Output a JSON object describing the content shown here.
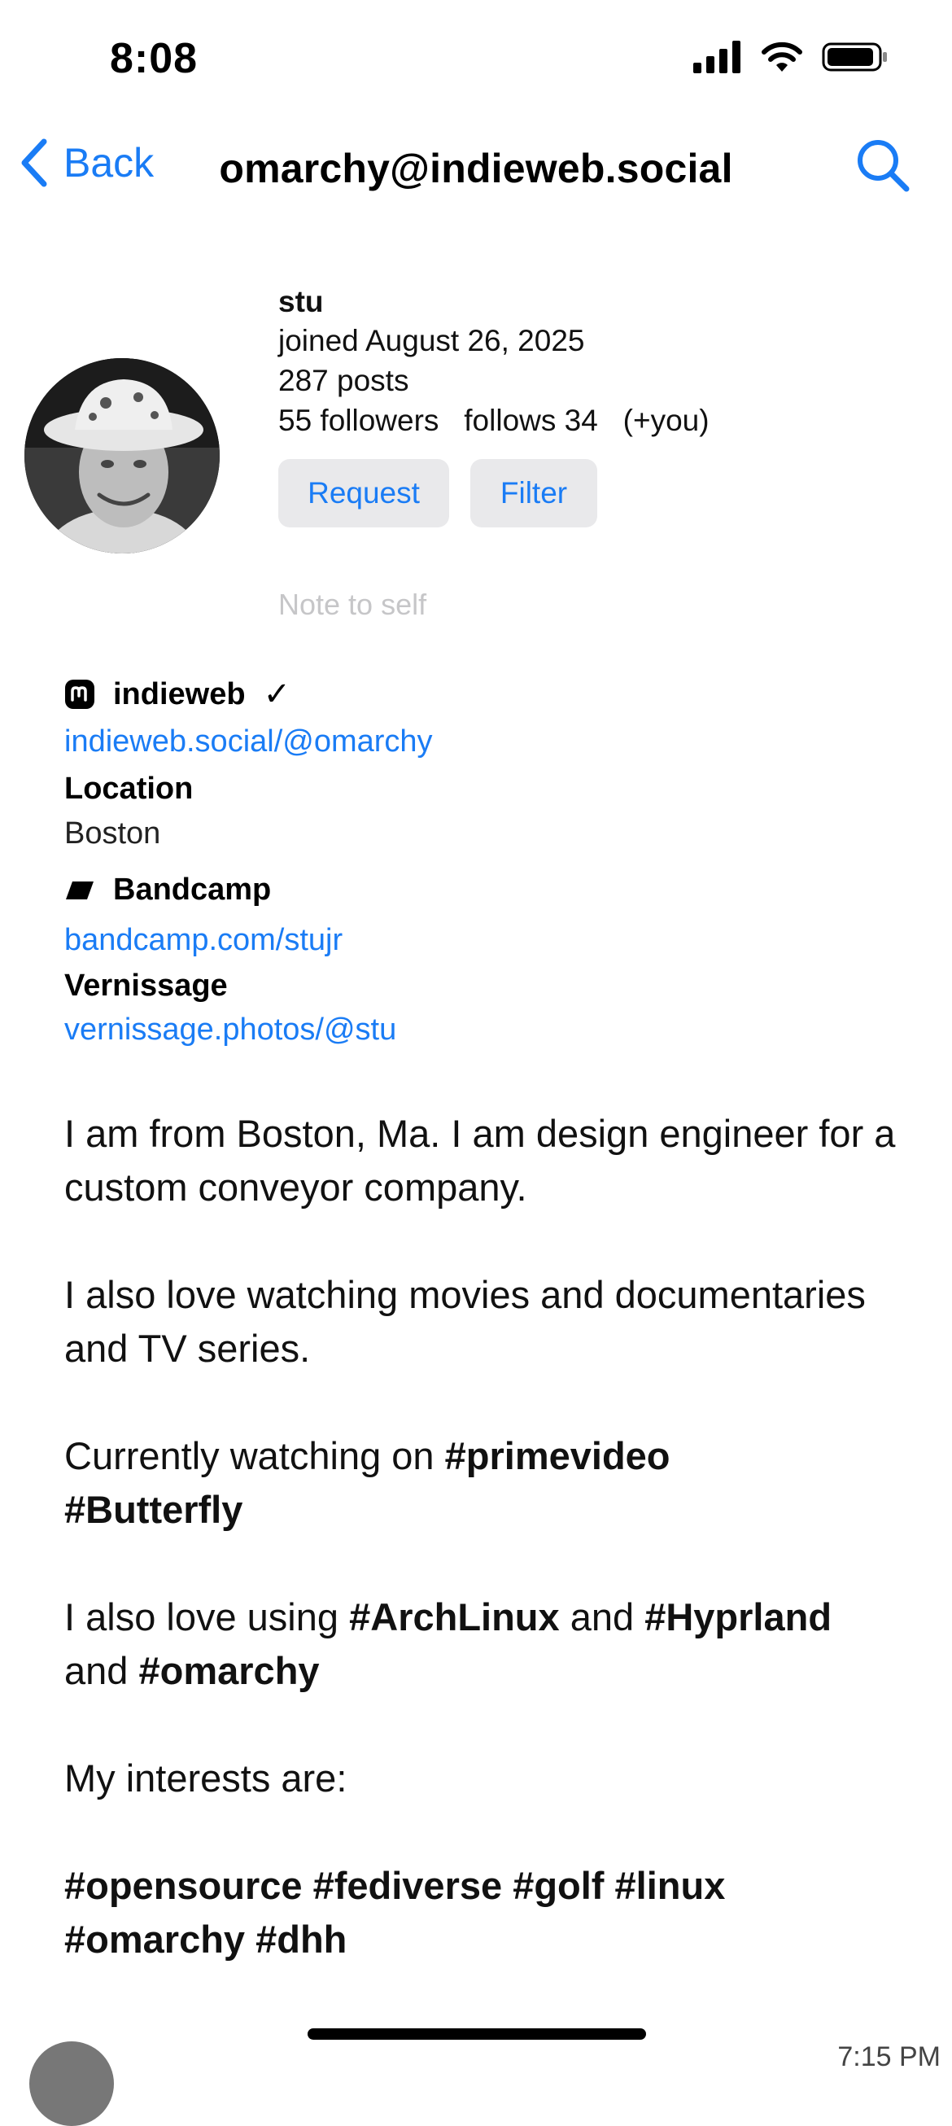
{
  "status_bar": {
    "time": "8:08"
  },
  "nav": {
    "back_label": "Back",
    "title": "omarchy@indieweb.social"
  },
  "profile": {
    "name": "stu",
    "joined": "joined August 26, 2025",
    "posts": "287 posts",
    "followers": "55 followers",
    "follows": "follows 34",
    "follows_you": "(+you)",
    "request_label": "Request",
    "filter_label": "Filter",
    "note_placeholder": "Note to self"
  },
  "fields": {
    "indieweb_label": "indieweb",
    "indieweb_check": "✓",
    "indieweb_url": "indieweb.social/@omarchy",
    "location_label": "Location",
    "location_value": "Boston",
    "bandcamp_label": "Bandcamp",
    "bandcamp_url": "bandcamp.com/stujr",
    "vernissage_label": "Vernissage",
    "vernissage_url": "vernissage.photos/@stu"
  },
  "bio": {
    "p1": "I am from Boston, Ma. I am design engineer for a custom conveyor company.",
    "p2": "I also love watching movies and documentaries and TV series.",
    "p3_text": "Currently watching on",
    "p3_tag1": "#primevideo",
    "p3_tag2": "#Butterfly",
    "p4_text1": "I also love using",
    "p4_tag1": "#ArchLinux",
    "p4_and1": "and",
    "p4_tag2": "#Hyprland",
    "p4_and2": "and",
    "p4_tag3": "#omarchy",
    "p5": "My interests are:",
    "p6_line1": "#opensource #fediverse #golf #linux",
    "p6_line2": "#omarchy #dhh"
  },
  "peek": {
    "time": "7:15 PM"
  },
  "colors": {
    "accent": "#1a7cf5",
    "button_bg": "#e9e9eb",
    "placeholder": "#c6c6c8"
  }
}
